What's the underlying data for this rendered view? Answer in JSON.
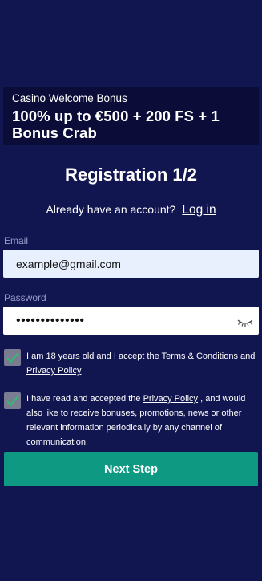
{
  "bonus": {
    "subtitle": "Casino Welcome Bonus",
    "title": "100% up to €500 + 200 FS + 1 Bonus Crab"
  },
  "registration": {
    "title": "Registration 1/2",
    "login_prompt": "Already have an account?",
    "login_link": "Log in"
  },
  "form": {
    "email_label": "Email",
    "email_value": "example@gmail.com",
    "password_label": "Password",
    "password_value": "••••••••••••••"
  },
  "consents": [
    {
      "checked": true,
      "text_before": "I am 18 years old and I accept the ",
      "link1": "Terms & Conditions",
      "text_middle": " and ",
      "link2": "Privacy Policy",
      "text_after": ""
    },
    {
      "checked": true,
      "text_before": "I have read and accepted the ",
      "link1": "Privacy Policy",
      "text_after": " , and would also like to receive bonuses, promotions, news or other relevant information periodically by any channel of communication."
    }
  ],
  "actions": {
    "next_label": "Next Step"
  },
  "colors": {
    "background": "#121650",
    "banner": "#0b0d38",
    "button": "#0e9a82",
    "checkmark": "#27c26b"
  }
}
